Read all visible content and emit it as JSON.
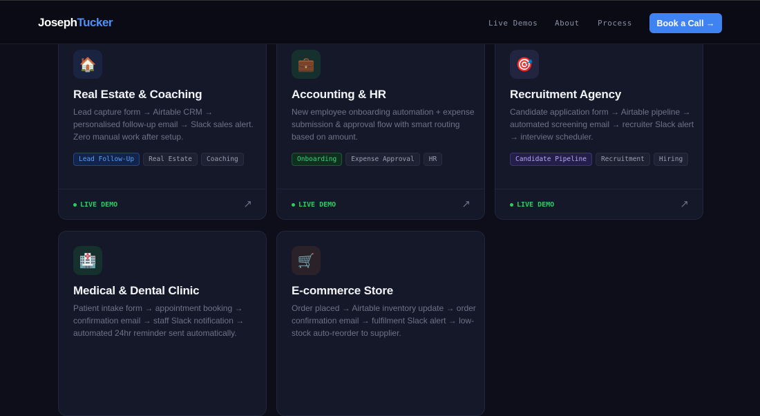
{
  "header": {
    "logo_first": "Joseph",
    "logo_second": "Tucker",
    "nav": [
      "Live Demos",
      "About",
      "Process"
    ],
    "cta": "Book a Call →"
  },
  "cards": [
    {
      "icon": "🏠",
      "title": "Real Estate & Coaching",
      "desc": "Lead capture form → Airtable CRM → personalised follow-up email → Slack sales alert. Zero manual work after setup.",
      "tags": [
        "Lead Follow-Up",
        "Real Estate",
        "Coaching"
      ],
      "live": "LIVE DEMO",
      "arrow": "↗"
    },
    {
      "icon": "💼",
      "title": "Accounting & HR",
      "desc": "New employee onboarding automation + expense submission & approval flow with smart routing based on amount.",
      "tags": [
        "Onboarding",
        "Expense Approval",
        "HR"
      ],
      "live": "LIVE DEMO",
      "arrow": "↗"
    },
    {
      "icon": "🎯",
      "title": "Recruitment Agency",
      "desc": "Candidate application form → Airtable pipeline → automated screening email → recruiter Slack alert → interview scheduler.",
      "tags": [
        "Candidate Pipeline",
        "Recruitment",
        "Hiring"
      ],
      "live": "LIVE DEMO",
      "arrow": "↗"
    },
    {
      "icon": "🏥",
      "title": "Medical & Dental Clinic",
      "desc": "Patient intake form → appointment booking → confirmation email → staff Slack notification → automated 24hr reminder sent automatically.",
      "tags": [],
      "live": "",
      "arrow": ""
    },
    {
      "icon": "🛒",
      "title": "E-commerce Store",
      "desc": "Order placed → Airtable inventory update → order confirmation email → fulfilment Slack alert → low-stock auto-reorder to supplier.",
      "tags": [],
      "live": "",
      "arrow": ""
    }
  ],
  "colors": {
    "accent": "#3f82f2",
    "live": "#2ecc5f"
  }
}
